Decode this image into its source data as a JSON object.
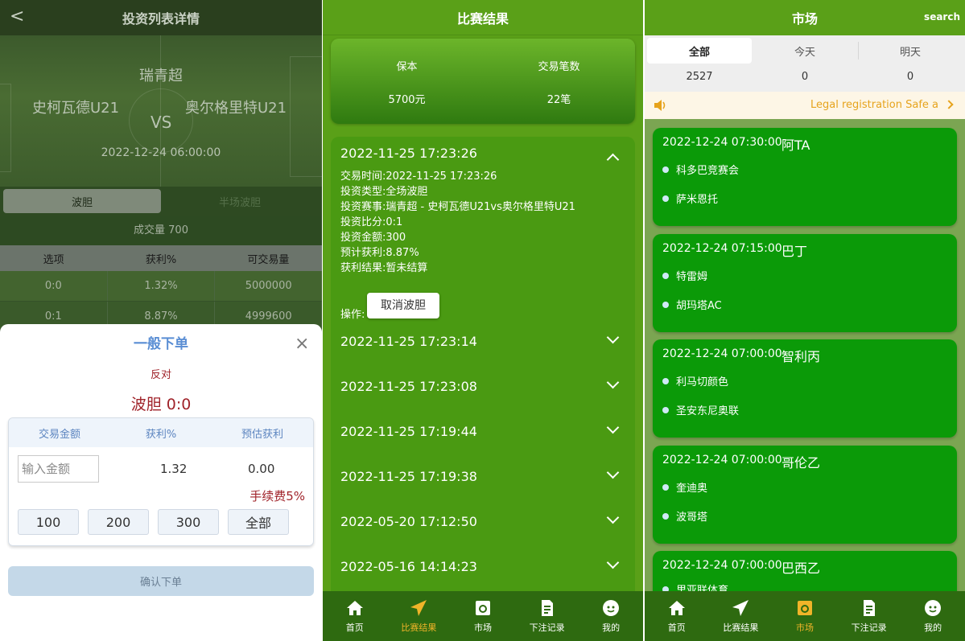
{
  "panel1": {
    "header": {
      "title": "投资列表详情",
      "back": "<"
    },
    "match": {
      "league": "瑞青超",
      "home": "史柯瓦德U21",
      "vs": "VS",
      "away": "奥尔格里特U21",
      "time": "2022-12-24 06:00:00"
    },
    "tabs": [
      {
        "label": "波胆"
      },
      {
        "label": "半场波胆"
      }
    ],
    "volume": "成交量 700",
    "table": {
      "headers": [
        "选项",
        "获利%",
        "可交易量"
      ],
      "rows": [
        [
          "0:0",
          "1.32%",
          "5000000"
        ],
        [
          "0:1",
          "8.87%",
          "4999600"
        ]
      ]
    },
    "order": {
      "title": "一般下单",
      "close": "×",
      "direction": "反对",
      "pick": "波胆 0:0",
      "headers": [
        "交易金额",
        "获利%",
        "预估获利"
      ],
      "amount_placeholder": "输入金额",
      "profit_rate": "1.32",
      "estimate": "0.00",
      "fee": "手续费5%",
      "quick": [
        "100",
        "200",
        "300",
        "全部"
      ],
      "confirm": "确认下单"
    }
  },
  "panel2": {
    "header": {
      "title": "比赛结果"
    },
    "summary": {
      "principal_label": "保本",
      "principal_value": "5700元",
      "count_label": "交易笔数",
      "count_value": "22笔"
    },
    "records": [
      {
        "time": "2022-11-25 17:23:26",
        "expanded": true
      },
      {
        "time": "2022-11-25 17:23:14"
      },
      {
        "time": "2022-11-25 17:23:08"
      },
      {
        "time": "2022-11-25 17:19:44"
      },
      {
        "time": "2022-11-25 17:19:38"
      },
      {
        "time": "2022-05-20 17:12:50"
      },
      {
        "time": "2022-05-16 14:14:23"
      }
    ],
    "details": [
      "交易时间:2022-11-25 17:23:26",
      "投资类型:全场波胆",
      "投资赛事:瑞青超 - 史柯瓦德U21vs奥尔格里特U21",
      "投资比分:0:1",
      "投资金额:300",
      "预计获利:8.87%",
      "获利结果:暂未结算"
    ],
    "operation_label": "操作:",
    "cancel_button": "取消波胆"
  },
  "panel3": {
    "header": {
      "title": "市场",
      "search": "search"
    },
    "day_tabs": [
      {
        "label": "全部",
        "count": "2527"
      },
      {
        "label": "今天",
        "count": "0"
      },
      {
        "label": "明天",
        "count": "0"
      }
    ],
    "notice": "Legal registration Safe a",
    "matches": [
      {
        "time": "2022-12-24 07:30:00",
        "league": "阿TA",
        "home": "科多巴竞赛会",
        "away": "萨米恩托"
      },
      {
        "time": "2022-12-24 07:15:00",
        "league": "巴丁",
        "home": "特雷姆",
        "away": "胡玛塔AC"
      },
      {
        "time": "2022-12-24 07:00:00",
        "league": "智利丙",
        "home": "利马切颜色",
        "away": "圣安东尼奥联"
      },
      {
        "time": "2022-12-24 07:00:00",
        "league": "哥伦乙",
        "home": "奎迪奥",
        "away": "波哥塔"
      },
      {
        "time": "2022-12-24 07:00:00",
        "league": "巴西乙",
        "home": "里亚联体育",
        "away": ""
      }
    ]
  },
  "tabbar": [
    {
      "label": "首页",
      "icon": "home-icon"
    },
    {
      "label": "比赛结果",
      "icon": "send-icon"
    },
    {
      "label": "市场",
      "icon": "market-icon"
    },
    {
      "label": "下注记录",
      "icon": "records-icon"
    },
    {
      "label": "我的",
      "icon": "profile-icon"
    }
  ],
  "colors": {
    "brand_green": "#5aa018",
    "card_green": "#0b9a08",
    "accent_orange": "#f0b429",
    "link_blue": "#5a8ed4",
    "warn_red": "#a0232a"
  }
}
